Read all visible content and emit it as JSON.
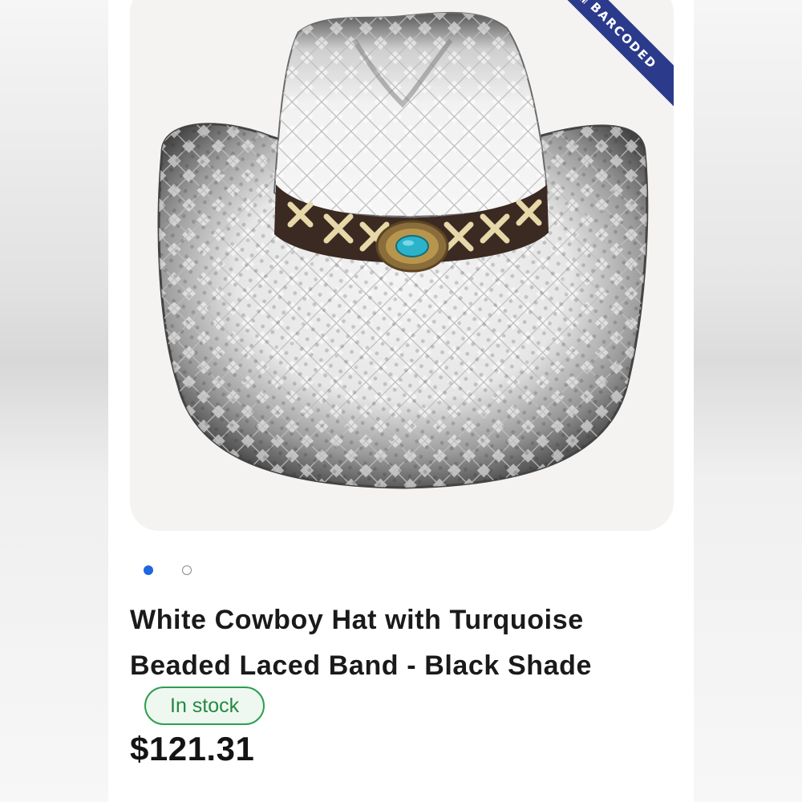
{
  "product": {
    "title": "White Cowboy Hat with Turquoise Beaded Laced Band - Black Shade",
    "stock_status": "In stock",
    "price": "$121.31",
    "image_ribbon": "BARCODED"
  },
  "carousel": {
    "count": 2,
    "active_index": 0
  },
  "colors": {
    "active_dot": "#1f66e0",
    "stock_green": "#2e9e4f",
    "ribbon_blue": "#2c3a8c"
  }
}
